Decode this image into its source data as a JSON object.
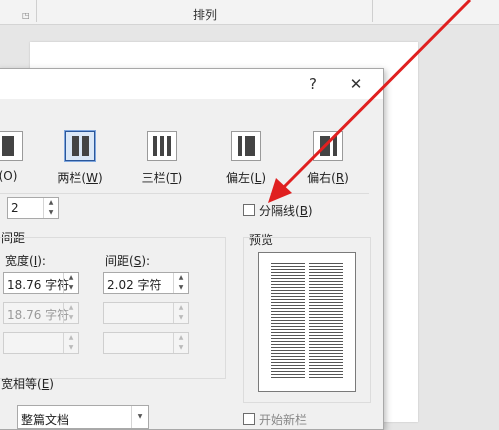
{
  "ribbon": {
    "group_label": "排列"
  },
  "dialog": {
    "help_label": "?",
    "close_label": "✕",
    "presets": [
      {
        "label": "(O)",
        "cols": 1
      },
      {
        "label_main": "两栏(",
        "label_key": "W",
        "label_end": ")",
        "cols": 2,
        "selected": true
      },
      {
        "label_main": "三栏(",
        "label_key": "T",
        "label_end": ")",
        "cols": 3
      },
      {
        "label_main": "偏左(",
        "label_key": "L",
        "label_end": ")",
        "cols": 2
      },
      {
        "label_main": "偏右(",
        "label_key": "R",
        "label_end": ")",
        "cols": 2
      }
    ],
    "num_columns_value": "2",
    "separator": {
      "main": "分隔线(",
      "key": "B",
      "end": ")",
      "checked": false
    },
    "section_label": "间距",
    "width_header": {
      "main": "宽度(",
      "key": "I",
      "end": "):"
    },
    "spacing_header": {
      "main": "间距(",
      "key": "S",
      "end": "):"
    },
    "rows": [
      {
        "width": "18.76 字符",
        "spacing": "2.02 字符",
        "enabled": true
      },
      {
        "width": "18.76 字符",
        "spacing": "",
        "enabled": false
      },
      {
        "width": "",
        "spacing": "",
        "enabled": false
      }
    ],
    "equal_width": {
      "main": "宽相等(",
      "key": "E",
      "end": ")"
    },
    "preview_label": "预览",
    "apply_to_value": "整篇文档",
    "new_column_label": "开始新栏"
  },
  "annotation": {
    "color": "#e02020"
  }
}
